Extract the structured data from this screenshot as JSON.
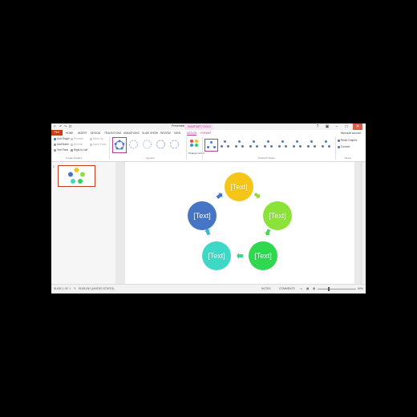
{
  "titlebar": {
    "qat": [
      "P",
      "↶",
      "↷",
      "⊡"
    ],
    "title": "Presentation1 - PowerPoint",
    "contextual_header": "SMARTART TOOLS",
    "window_buttons": [
      "?",
      "▣",
      "–",
      "□",
      "✕"
    ]
  },
  "tabs": {
    "file": "FILE",
    "items": [
      "HOME",
      "INSERT",
      "DESIGN",
      "TRANSITIONS",
      "ANIMATIONS",
      "SLIDE SHOW",
      "REVIEW",
      "VIEW",
      "DESIGN",
      "FORMAT"
    ],
    "account": "Microsoft account"
  },
  "ribbon": {
    "create_graphic": {
      "buttons": [
        "Add Shape",
        "Add Bullet",
        "Text Pane",
        "Promote",
        "Demote",
        "Right to Left",
        "Move Up",
        "Move Down"
      ],
      "group_label": "Create Graphic"
    },
    "layouts": {
      "group_label": "Layouts"
    },
    "change_colors": "Change Colors",
    "styles": {
      "group_label": "SmartArt Styles"
    },
    "reset": {
      "buttons": [
        "Reset Graphic",
        "Convert"
      ],
      "group_label": "Reset"
    }
  },
  "thumbnails": {
    "slide_number": "1"
  },
  "diagram": {
    "nodes": [
      {
        "label": "[Text]",
        "color": "#F5C518"
      },
      {
        "label": "[Text]",
        "color": "#8BE33A"
      },
      {
        "label": "[Text]",
        "color": "#2FD84F"
      },
      {
        "label": "[Text]",
        "color": "#3FD8C6"
      },
      {
        "label": "[Text]",
        "color": "#4575C4"
      }
    ]
  },
  "statusbar": {
    "slide_info": "SLIDE 1 OF 1",
    "language": "ENGLISH (UNITED STATES)",
    "notes": "NOTES",
    "comments": "COMMENTS",
    "zoom": "60%"
  },
  "colors": {
    "accent": "#C43E1C",
    "contextual": "#B3408F"
  }
}
